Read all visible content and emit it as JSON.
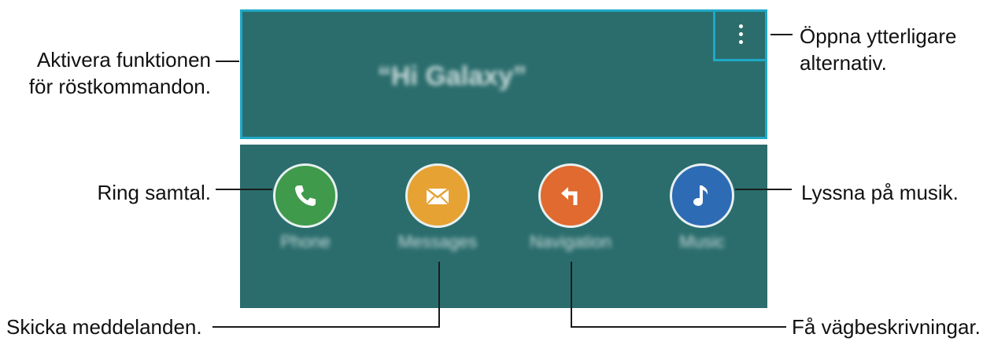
{
  "wake": {
    "phrase": "“Hi Galaxy”"
  },
  "menu": {
    "icon": "more-vertical-icon"
  },
  "apps": [
    {
      "label": "Phone",
      "icon": "phone-icon",
      "color": "#3f9a4b"
    },
    {
      "label": "Messages",
      "icon": "envelope-icon",
      "color": "#e6a233"
    },
    {
      "label": "Navigation",
      "icon": "turn-left-arrow-icon",
      "color": "#e06a2f"
    },
    {
      "label": "Music",
      "icon": "music-note-icon",
      "color": "#2e6bb5"
    }
  ],
  "callouts": {
    "activate_line1": "Aktivera funktionen",
    "activate_line2": "för röstkommandon.",
    "options_line1": "Öppna ytterligare",
    "options_line2": "alternativ.",
    "call": "Ring samtal.",
    "music": "Lyssna på musik.",
    "messages": "Skicka meddelanden.",
    "directions": "Få vägbeskrivningar."
  },
  "colors": {
    "panel": "#2b6d6d",
    "highlight": "#1ea9c6"
  }
}
